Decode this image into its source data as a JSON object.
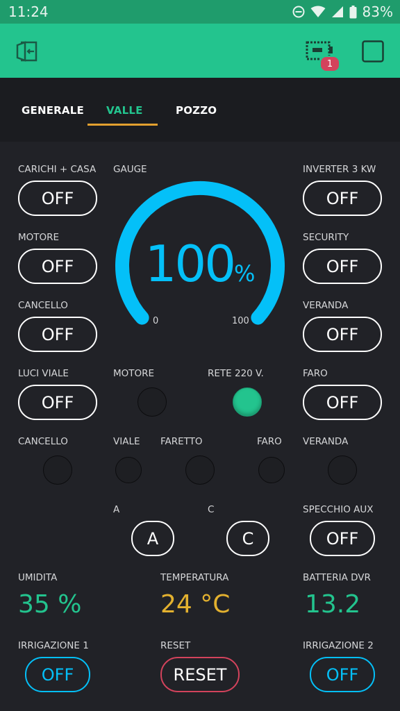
{
  "status": {
    "time": "11:24",
    "battery": "83%"
  },
  "appbar": {
    "notification_count": "1"
  },
  "tabs": [
    "GENERALE",
    "VALLE",
    "POZZO"
  ],
  "switches": {
    "carichi_casa": {
      "label": "CARICHI + CASA",
      "state": "OFF"
    },
    "motore": {
      "label": "MOTORE",
      "state": "OFF"
    },
    "cancello": {
      "label": "CANCELLO",
      "state": "OFF"
    },
    "luci_viale": {
      "label": "LUCI VIALE",
      "state": "OFF"
    },
    "inverter": {
      "label": "INVERTER 3 KW",
      "state": "OFF"
    },
    "security": {
      "label": "SECURITY",
      "state": "OFF"
    },
    "veranda": {
      "label": "VERANDA",
      "state": "OFF"
    },
    "faro": {
      "label": "FARO",
      "state": "OFF"
    },
    "specchio_aux": {
      "label": "SPECCHIO AUX",
      "state": "OFF"
    },
    "irrigazione1": {
      "label": "IRRIGAZIONE 1",
      "state": "OFF"
    },
    "irrigazione2": {
      "label": "IRRIGAZIONE 2",
      "state": "OFF"
    }
  },
  "gauge": {
    "label": "GAUGE",
    "value": "100",
    "unit": "%",
    "min": "0",
    "max": "100",
    "fraction": 1.0,
    "color": "#04c0f8"
  },
  "leds": {
    "motore": {
      "label": "MOTORE",
      "on": false
    },
    "rete": {
      "label": "RETE  220 V.",
      "on": true
    },
    "cancello": {
      "label": "CANCELLO",
      "on": false
    },
    "viale": {
      "label": "VIALE",
      "on": false
    },
    "faretto": {
      "label": "FARETTO",
      "on": false
    },
    "faro": {
      "label": "FARO",
      "on": false
    },
    "veranda": {
      "label": "VERANDA",
      "on": false
    }
  },
  "buttons": {
    "a": {
      "label": "A",
      "text": "A"
    },
    "c": {
      "label": "C",
      "text": "C"
    },
    "reset": {
      "label": "RESET",
      "text": "RESET"
    }
  },
  "values": {
    "umidita": {
      "label": "UMIDITA",
      "value": "35 %",
      "color": "#23c48e"
    },
    "temperatura": {
      "label": "TEMPERATURA",
      "value": "24 °C",
      "color": "#e3b12f"
    },
    "batteria": {
      "label": "BATTERIA  DVR",
      "value": "13.2",
      "color": "#23c48e"
    }
  },
  "colors": {
    "accent": "#23c48e",
    "tab_underline": "#e3a02f",
    "gauge": "#04c0f8",
    "reset": "#d3435c",
    "background": "#212227"
  }
}
